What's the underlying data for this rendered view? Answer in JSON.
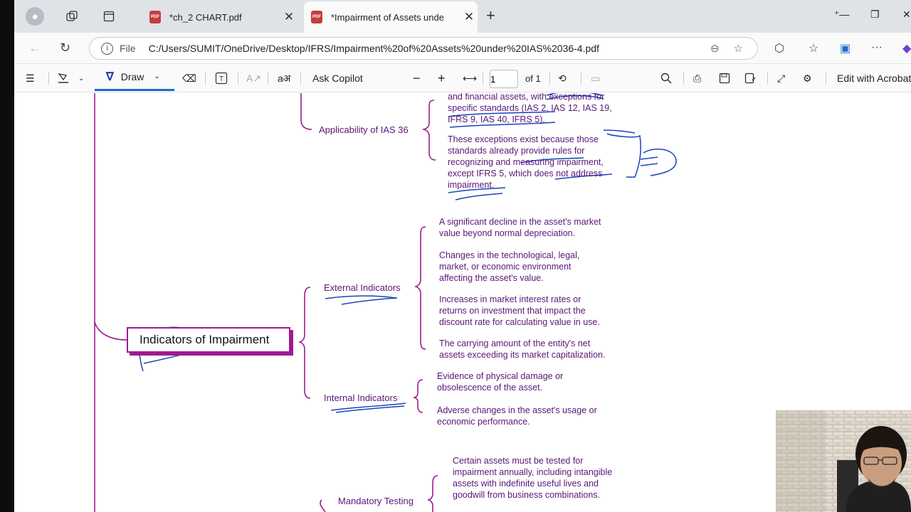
{
  "tabs": [
    {
      "title": "*ch_2 CHART.pdf",
      "icon": "pdf-icon"
    },
    {
      "title": "*Impairment of Assets unde",
      "icon": "pdf-icon"
    }
  ],
  "address": {
    "file_label": "File",
    "url": "C:/Users/SUMIT/OneDrive/Desktop/IFRS/Impairment%20of%20Assets%20under%20IAS%2036-4.pdf"
  },
  "pdf_toolbar": {
    "draw_label": "Draw",
    "ask_copilot": "Ask Copilot",
    "page_current": "1",
    "page_total": "of 1",
    "edit_label": "Edit with Acrobat"
  },
  "document": {
    "applicability": {
      "label": "Applicability of IAS 36",
      "lines1": [
        "and financial assets, with exceptions for",
        "specific standards (IAS 2, IAS 12, IAS 19,",
        "IFRS 9, IAS 40, IFRS 5)."
      ],
      "lines2": [
        "These exceptions exist because those",
        "standards already provide rules for",
        "recognizing and measuring impairment,",
        "except IFRS 5, which does not address",
        "impairment."
      ]
    },
    "root": "Indicators of Impairment",
    "external": {
      "label": "External Indicators",
      "items": [
        [
          "A significant decline in the asset's market",
          "value beyond normal depreciation."
        ],
        [
          "Changes in the technological, legal,",
          "market, or economic environment",
          "affecting the asset's value."
        ],
        [
          "Increases in market interest rates or",
          "returns on investment that impact the",
          "discount rate for calculating value in use."
        ],
        [
          "The carrying amount of the entity's net",
          "assets exceeding its market capitalization."
        ]
      ]
    },
    "internal": {
      "label": "Internal Indicators",
      "items": [
        [
          "Evidence of physical damage or",
          "obsolescence of the asset."
        ],
        [
          "Adverse changes in the asset's usage or",
          "economic performance."
        ]
      ]
    },
    "mandatory": {
      "label": "Mandatory Testing",
      "lines": [
        "Certain assets must be tested for",
        "impairment annually, including intangible",
        "assets with indefinite useful lives and",
        "goodwill from business combinations."
      ]
    }
  },
  "colors": {
    "mindmap_line": "#9c1c8f",
    "mindmap_text": "#5a1677",
    "ink": "#1a44b8",
    "draw_accent": "#1d6ad1"
  }
}
